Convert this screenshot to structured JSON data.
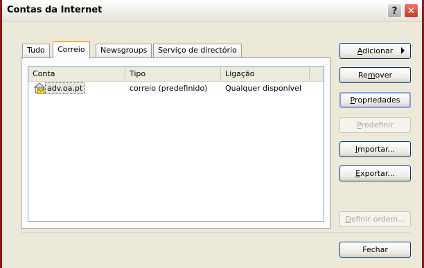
{
  "window": {
    "title": "Contas da Internet"
  },
  "titlebar_buttons": {
    "help": "?",
    "close": "✕"
  },
  "tabs": [
    {
      "label": "Tudo",
      "active": false
    },
    {
      "label": "Correio",
      "active": true
    },
    {
      "label": "Newsgroups",
      "active": false
    },
    {
      "label": "Serviço de directório",
      "active": false
    }
  ],
  "list": {
    "columns": [
      "Conta",
      "Tipo",
      "Ligação"
    ],
    "rows": [
      {
        "conta": "adv.oa.pt",
        "tipo": "correio (predefinido)",
        "ligacao": "Qualquer disponível",
        "icon": "mail-account-icon"
      }
    ]
  },
  "buttons": {
    "adicionar": {
      "prefix": "",
      "mnemonic": "A",
      "rest": "dicionar"
    },
    "remover": {
      "prefix": "Re",
      "mnemonic": "m",
      "rest": "over"
    },
    "propriedades": {
      "prefix": "",
      "mnemonic": "P",
      "rest": "ropriedades"
    },
    "predefinir": {
      "prefix": "",
      "mnemonic": "P",
      "rest": "redefinir"
    },
    "importar": {
      "prefix": "",
      "mnemonic": "I",
      "rest": "mportar..."
    },
    "exportar": {
      "prefix": "",
      "mnemonic": "E",
      "rest": "xportar..."
    },
    "definir_ordem": {
      "prefix": "",
      "mnemonic": "D",
      "rest": "efinir ordem..."
    },
    "fechar": {
      "label": "Fechar"
    }
  },
  "colors": {
    "frame": "#8b1a1a",
    "dialog_bg": "#ece9d8",
    "active_tab_accent": "#f0b33a"
  }
}
